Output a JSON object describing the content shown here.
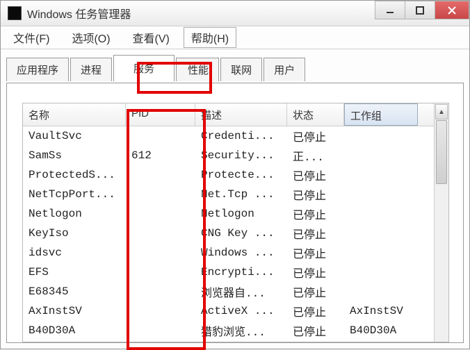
{
  "window": {
    "title": "Windows 任务管理器"
  },
  "menu": {
    "file": "文件(F)",
    "option": "选项(O)",
    "view": "查看(V)",
    "help": "帮助(H)"
  },
  "tabs": {
    "apps": "应用程序",
    "proc": "进程",
    "services": "服务",
    "perf": "性能",
    "net": "联网",
    "users": "用户"
  },
  "columns": {
    "name": "名称",
    "pid": "PID",
    "desc": "描述",
    "state": "状态",
    "group": "工作组"
  },
  "rows": [
    {
      "name": "VaultSvc",
      "pid": "",
      "desc": "Credenti...",
      "state": "已停止",
      "group": ""
    },
    {
      "name": "SamSs",
      "pid": "612",
      "desc": "Security...",
      "state": "正...",
      "group": ""
    },
    {
      "name": "ProtectedS...",
      "pid": "",
      "desc": "Protecte...",
      "state": "已停止",
      "group": ""
    },
    {
      "name": "NetTcpPort...",
      "pid": "",
      "desc": "Net.Tcp ...",
      "state": "已停止",
      "group": ""
    },
    {
      "name": "Netlogon",
      "pid": "",
      "desc": "Netlogon",
      "state": "已停止",
      "group": ""
    },
    {
      "name": "KeyIso",
      "pid": "",
      "desc": "CNG Key ...",
      "state": "已停止",
      "group": ""
    },
    {
      "name": "idsvc",
      "pid": "",
      "desc": "Windows ...",
      "state": "已停止",
      "group": ""
    },
    {
      "name": "EFS",
      "pid": "",
      "desc": "Encrypti...",
      "state": "已停止",
      "group": ""
    },
    {
      "name": "E68345",
      "pid": "",
      "desc": "浏览器自...",
      "state": "已停止",
      "group": ""
    },
    {
      "name": "AxInstSV",
      "pid": "",
      "desc": "ActiveX ...",
      "state": "已停止",
      "group": "AxInstSV"
    },
    {
      "name": "B40D30A",
      "pid": "",
      "desc": "猎豹浏览...",
      "state": "已停止",
      "group": "B40D30A"
    }
  ],
  "highlight": {
    "services_tab": true,
    "pid_column": true
  }
}
